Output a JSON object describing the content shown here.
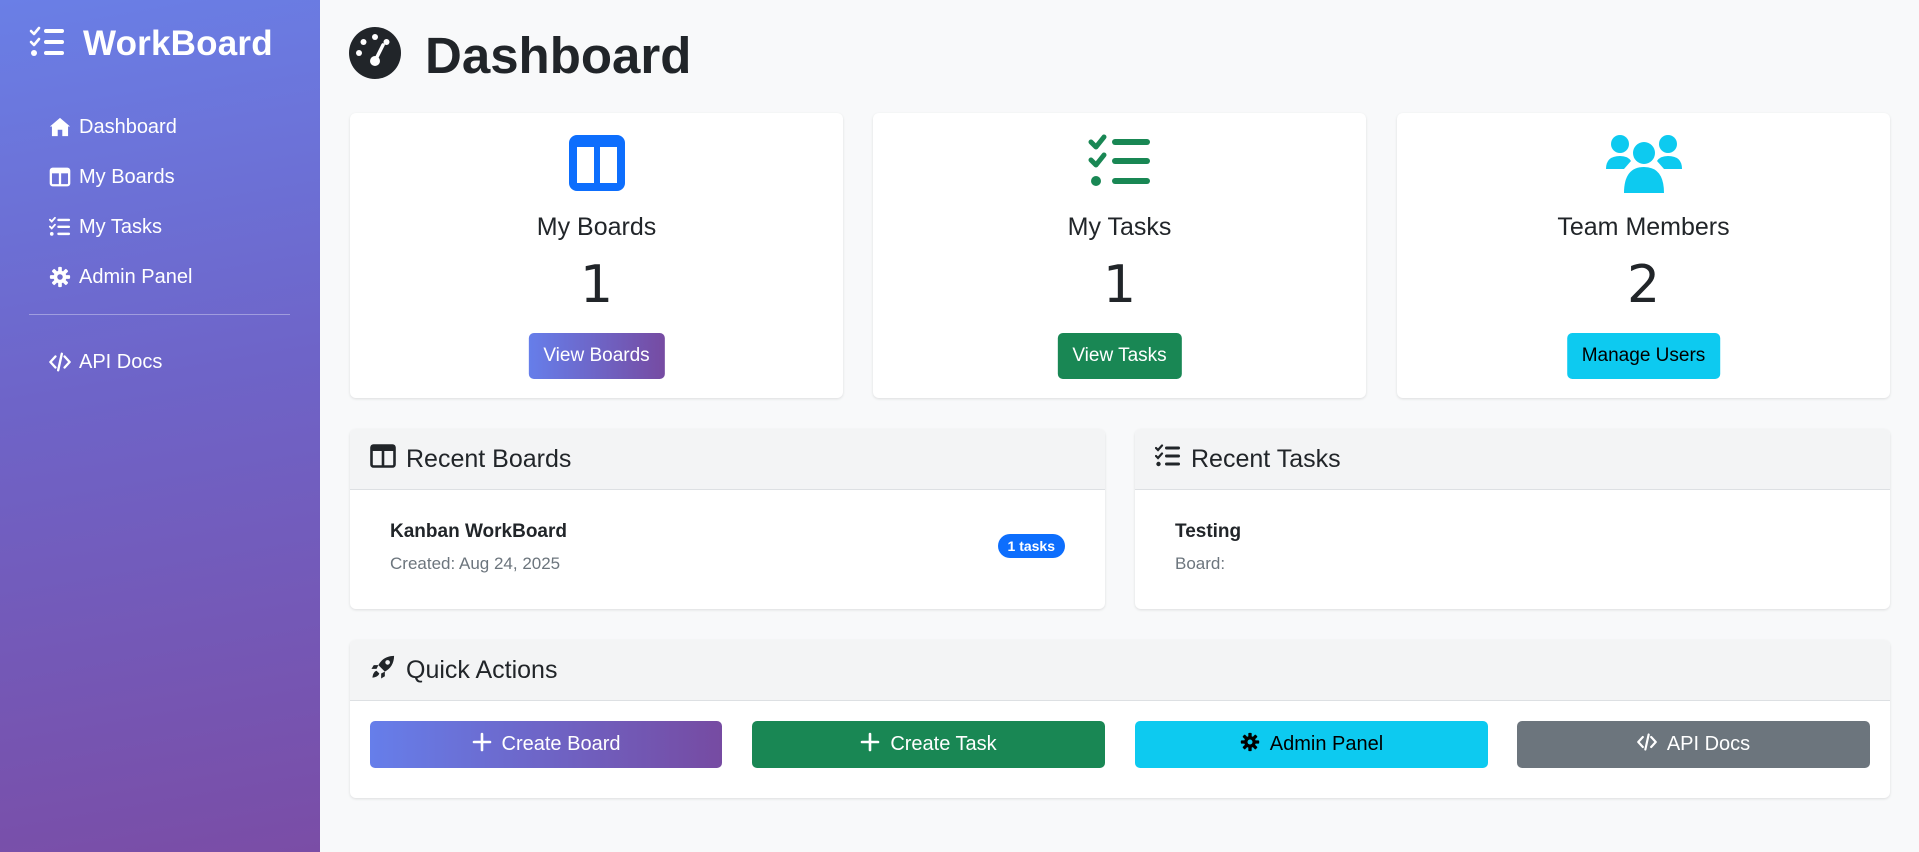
{
  "sidebar": {
    "brand": "WorkBoard",
    "items": [
      {
        "label": "Dashboard",
        "icon": "home-icon"
      },
      {
        "label": "My Boards",
        "icon": "columns-icon"
      },
      {
        "label": "My Tasks",
        "icon": "tasks-icon"
      },
      {
        "label": "Admin Panel",
        "icon": "gear-icon"
      }
    ],
    "secondary": [
      {
        "label": "API Docs",
        "icon": "code-icon"
      }
    ]
  },
  "page": {
    "title": "Dashboard"
  },
  "stats": [
    {
      "label": "My Boards",
      "value": "1",
      "button": "View Boards",
      "icon": "columns-icon",
      "color": "#0d6efd"
    },
    {
      "label": "My Tasks",
      "value": "1",
      "button": "View Tasks",
      "icon": "tasks-icon",
      "color": "#198754"
    },
    {
      "label": "Team Members",
      "value": "2",
      "button": "Manage Users",
      "icon": "users-icon",
      "color": "#0dcaf0"
    }
  ],
  "recent_boards": {
    "title": "Recent Boards",
    "items": [
      {
        "name": "Kanban WorkBoard",
        "meta": "Created: Aug 24, 2025",
        "badge": "1 tasks"
      }
    ]
  },
  "recent_tasks": {
    "title": "Recent Tasks",
    "items": [
      {
        "name": "Testing",
        "meta": "Board:"
      }
    ]
  },
  "quick_actions": {
    "title": "Quick Actions",
    "buttons": [
      {
        "label": "Create Board",
        "icon": "plus-icon"
      },
      {
        "label": "Create Task",
        "icon": "plus-icon"
      },
      {
        "label": "Admin Panel",
        "icon": "gear-icon"
      },
      {
        "label": "API Docs",
        "icon": "code-icon"
      }
    ]
  },
  "colors": {
    "primary_gradient_start": "#667eea",
    "primary_gradient_end": "#764ba2",
    "success": "#198754",
    "info": "#0dcaf0",
    "secondary": "#6c757d",
    "badge": "#0d6efd"
  }
}
